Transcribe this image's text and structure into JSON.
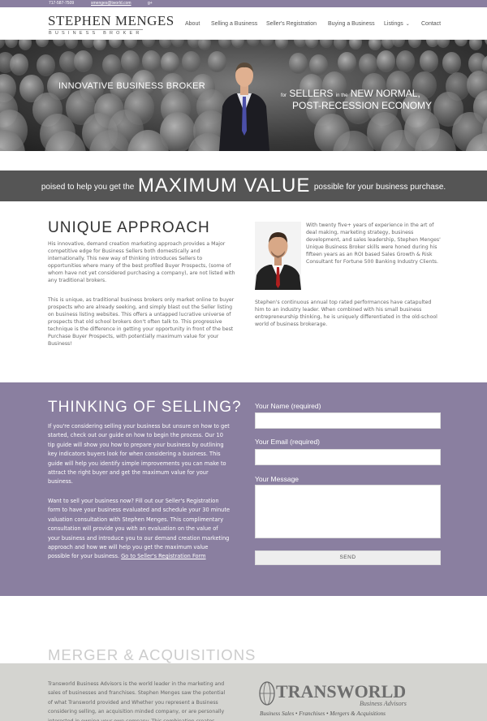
{
  "topbar": {
    "phone": "717-587-7509",
    "email": "smenges@tworld.com",
    "gplus": "g+"
  },
  "brand": {
    "name": "STEPHEN MENGES",
    "tagline": "BUSINESS BROKER"
  },
  "nav": {
    "items": [
      {
        "label": "About"
      },
      {
        "label": "Selling a Business"
      },
      {
        "label": "Seller's Registration"
      },
      {
        "label": "Buying a Business"
      },
      {
        "label": "Listings"
      },
      {
        "label": "Contact"
      }
    ]
  },
  "hero": {
    "left_text": "INNOVATIVE BUSINESS BROKER",
    "right_for": "for",
    "right_sellers": "SELLERS",
    "right_in_the": "in the",
    "right_new_normal": "NEW NORMAL,",
    "right_line2": "POST-RECESSION ECONOMY"
  },
  "banner": {
    "pre": "poised to help you get the",
    "highlight": "MAXIMUM VALUE",
    "post": "possible for your business purchase."
  },
  "unique": {
    "title": "UNIQUE APPROACH",
    "p1": "His innovative, demand creation marketing approach provides a Major competitive edge for Business Sellers both domestically and internationally. This new way of thinking introduces Sellers to opportunities where many of the best profiled Buyer Prospects, (some of whom have not yet considered purchasing a company), are not listed with any traditional brokers.",
    "p2": "This is unique, as traditional business brokers only market online to buyer prospects who are already seeking, and simply blast out the Seller listing on business listing websites. This offers a untapped lucrative universe of prospects that old school brokers don't often talk to. This progressive technique is the difference in getting your opportunity in front of the best Purchase Buyer Prospects, with potentially maximum value for your Business!",
    "bio1": "With twenty five+ years of experience in the art of deal making, marketing strategy, business development, and sales leadership, Stephen Menges' Unique Business Broker skills were honed during his fifteen years as an ROI based Sales Growth & Risk Consultant for Fortune 500 Banking Industry Clients.",
    "bio2": "Stephen's continuous annual top rated performances have catapulted him to an industry leader. When combined with his small business entrepreneurship thinking, he is uniquely differentiated in the old-school world of business brokerage."
  },
  "selling": {
    "title": "THINKING OF SELLING?",
    "p1": "If you're considering selling your business but unsure on how to get started, check out our guide on how to begin the process. Our 10 tip guide will show you how to prepare your business by outlining key indicators buyers look for when considering a business. This guide will help you identify simple improvements you can make to attract the right buyer and get the maximum value for your business.",
    "p2": "Want to sell your business now? Fill out our Seller's Registration form to have your business evaluated and schedule your 30 minute valuation consultation with Stephen Menges. This complimentary consultation will provide you with an evaluation on the value of your business and introduce you to our demand creation marketing approach and how we will help you get the maximum value possible for your business.",
    "link": "Go to Seller's Registration Form",
    "form": {
      "name_label": "Your Name (required)",
      "email_label": "Your Email (required)",
      "message_label": "Your Message",
      "name_value": "",
      "email_value": "",
      "message_value": "",
      "send_label": "SEND"
    }
  },
  "merger": {
    "title": "MERGER & ACQUISITIONS",
    "text": "Transworld Business Advisors is the world leader in the marketing and sales of businesses and franchises. Stephen Menges saw the potential of what Transworld provided and Whether you represent a Business considering selling, an acquisition minded company, or are personally interested in owning your own company. This combination creates",
    "logo_name": "TRANSWORLD",
    "logo_sub": "Business Advisors",
    "logo_tagline": "Business Sales • Franchises • Mergers & Acquisitions"
  },
  "colors": {
    "accent_purple": "#8a7fa0",
    "banner_gray": "#555555",
    "merger_bg": "#d4d4d0"
  }
}
